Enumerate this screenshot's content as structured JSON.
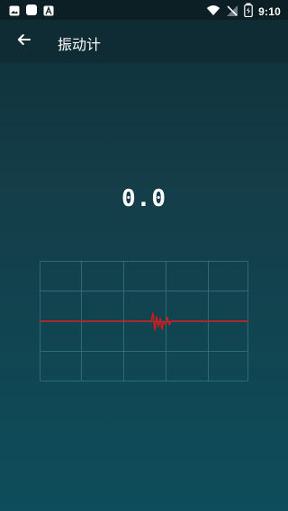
{
  "status_bar": {
    "time": "9:10",
    "left_icons": [
      "image-icon",
      "white-square-icon",
      "font-icon"
    ],
    "right_icons": [
      "wifi-icon",
      "no-signal-icon",
      "battery-icon"
    ]
  },
  "app_bar": {
    "title": "振动计",
    "back_icon": "arrow-back-icon"
  },
  "reading": {
    "value": "0.0"
  },
  "graph": {
    "line_color": "#d11a1a",
    "grid_color": "#2f6b73"
  }
}
